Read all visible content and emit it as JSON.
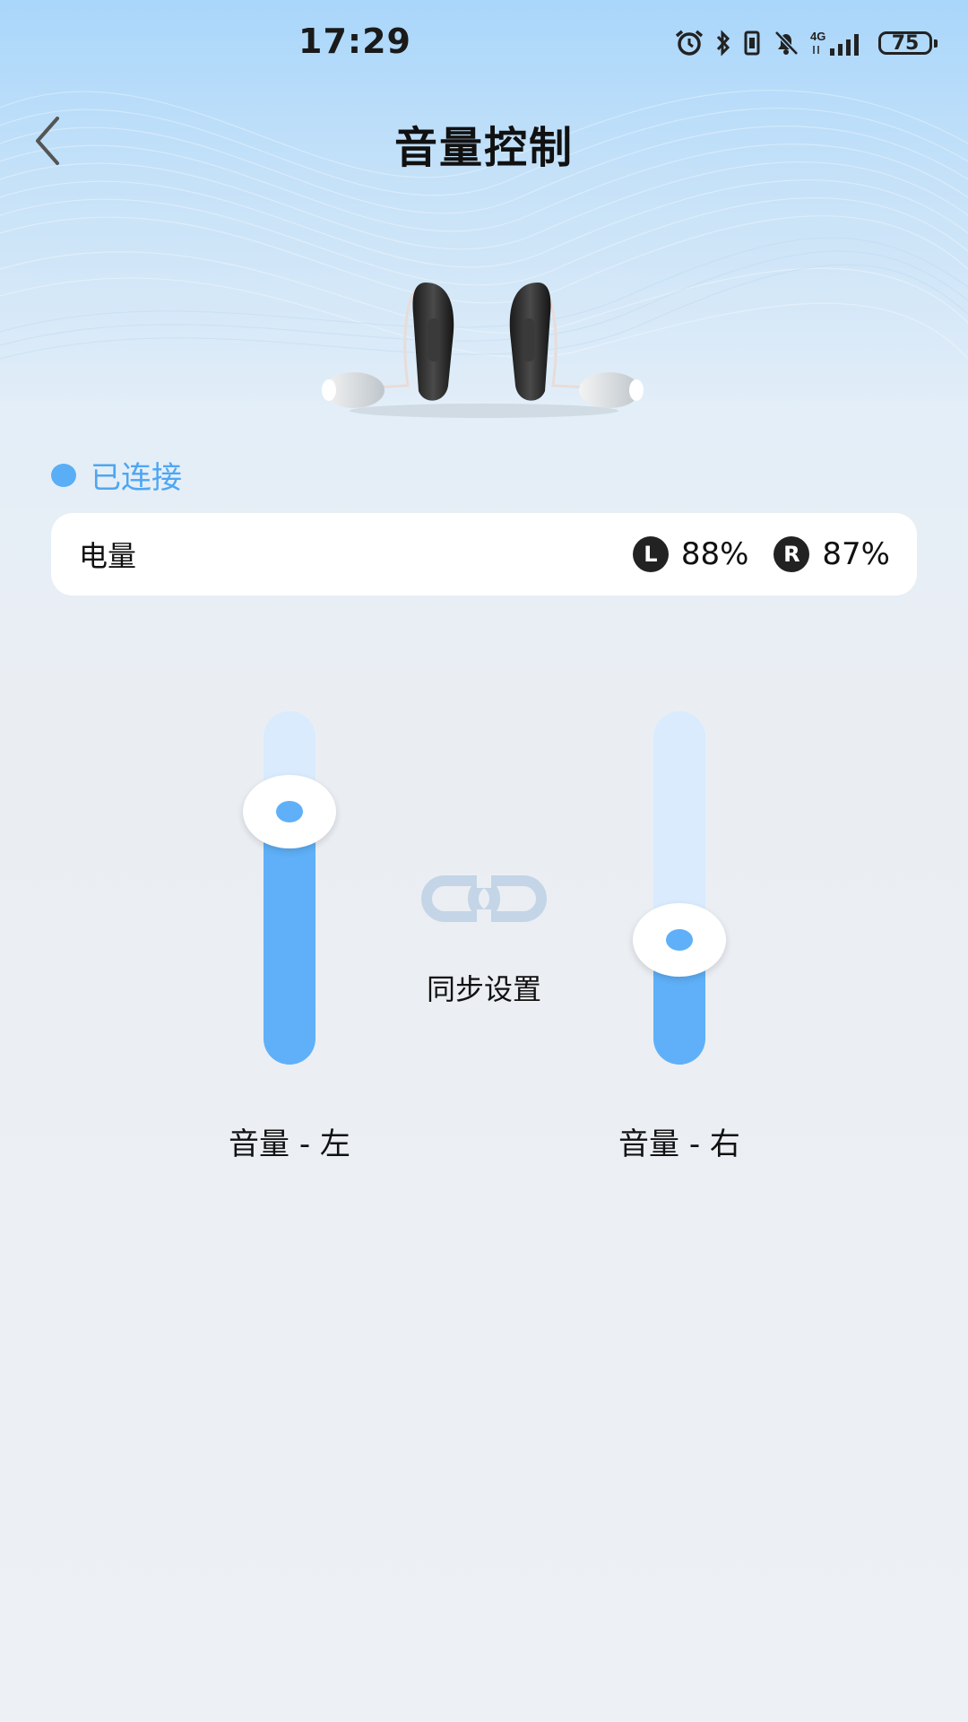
{
  "status_bar": {
    "time": "17:29",
    "battery": "75",
    "icons": [
      "alarm-icon",
      "bluetooth-icon",
      "vibrate-icon",
      "mute-icon",
      "4g-signal-icon",
      "battery-icon"
    ]
  },
  "header": {
    "title": "音量控制",
    "back_icon": "chevron-left-icon"
  },
  "connection": {
    "status": "已连接",
    "dot_color": "#5aaef6"
  },
  "battery_card": {
    "label": "电量",
    "left_badge": "L",
    "left_value": "88%",
    "right_badge": "R",
    "right_value": "87%"
  },
  "volume": {
    "left_label": "音量 - 左",
    "right_label": "音量 - 右",
    "left_level": 0.75,
    "right_level": 0.33,
    "sync_label": "同步设置",
    "sync_icon": "link-icon"
  },
  "colors": {
    "accent": "#5fb0f8",
    "track": "#d9ebfd"
  }
}
